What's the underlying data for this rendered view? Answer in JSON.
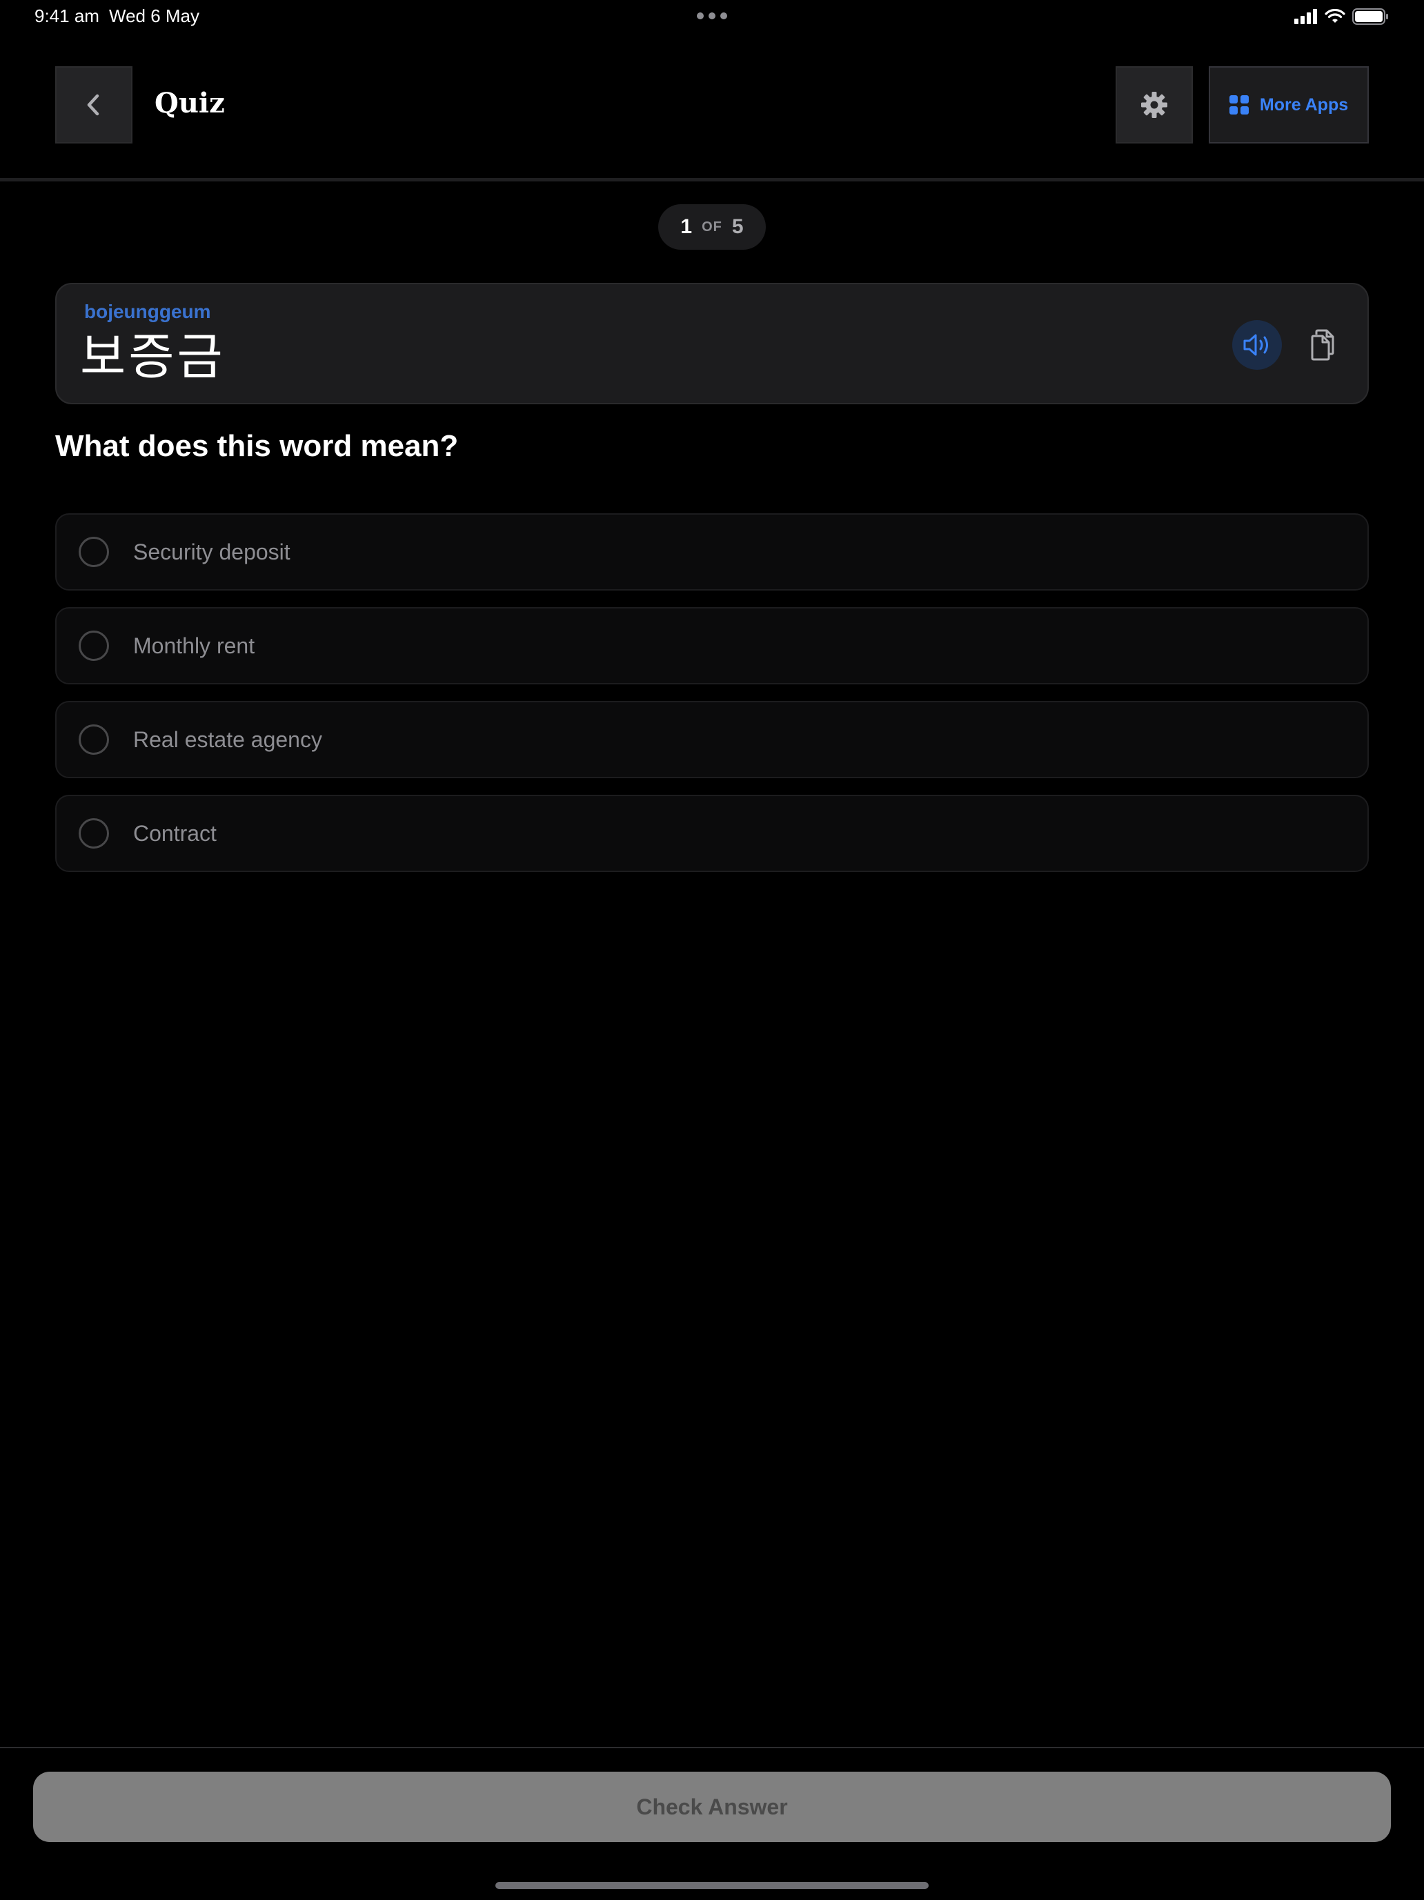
{
  "status_bar": {
    "time": "9:41 am",
    "date": "Wed 6 May"
  },
  "header": {
    "title": "Quiz",
    "back_icon": "chevron-left-icon",
    "settings_icon": "gear-icon",
    "more_apps_icon": "grid-icon",
    "more_apps_label": "More Apps"
  },
  "progress": {
    "current": "1",
    "of_label": "OF",
    "total": "5"
  },
  "word": {
    "romanization": "bojeunggeum",
    "hangul": "보증금",
    "speaker_icon": "speaker-icon",
    "copy_icon": "copy-icon"
  },
  "question": "What does this word mean?",
  "options": [
    {
      "label": "Security deposit"
    },
    {
      "label": "Monthly rent"
    },
    {
      "label": "Real estate agency"
    },
    {
      "label": "Contract"
    }
  ],
  "footer": {
    "check_label": "Check Answer"
  },
  "colors": {
    "accent": "#3a82f7",
    "background": "#000000",
    "card": "#1c1c1e",
    "disabled_button": "#808080"
  }
}
